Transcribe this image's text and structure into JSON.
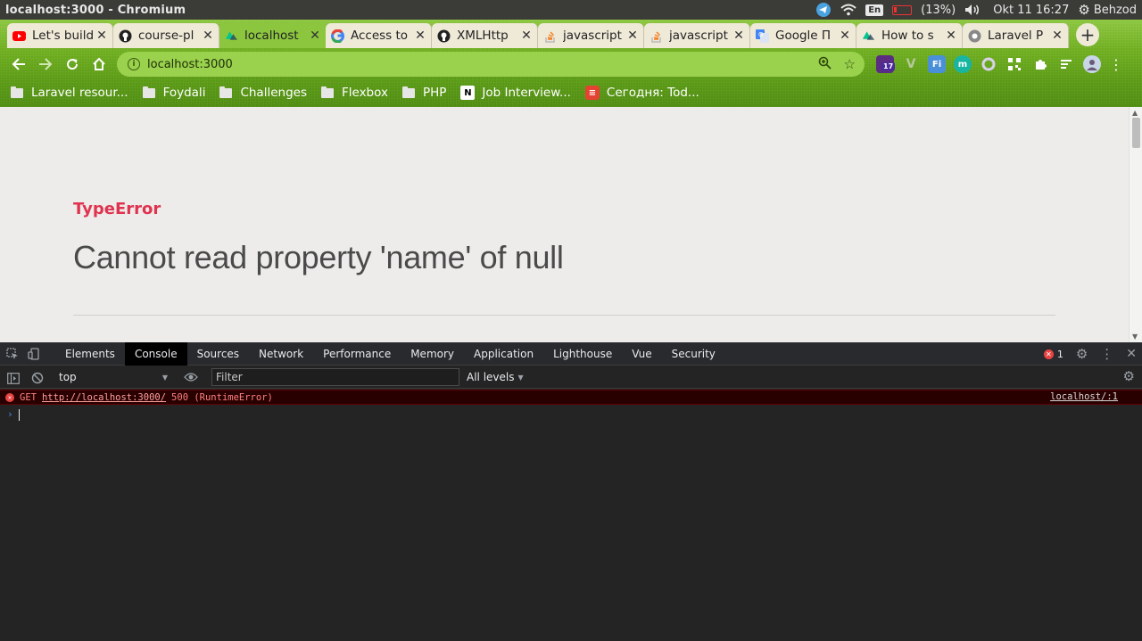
{
  "os": {
    "window_title": "localhost:3000 - Chromium",
    "lang": "En",
    "battery": "(13%)",
    "clock": "Okt 11 16:27",
    "user": "Behzod"
  },
  "tabs": [
    {
      "label": "Let's build",
      "icon": "youtube-icon",
      "active": false
    },
    {
      "label": "course-pl",
      "icon": "github-icon",
      "active": false
    },
    {
      "label": "localhost",
      "icon": "nuxt-icon",
      "active": true
    },
    {
      "label": "Access to",
      "icon": "google-icon",
      "active": false
    },
    {
      "label": "XMLHttp",
      "icon": "github-icon",
      "active": false
    },
    {
      "label": "javascript",
      "icon": "stackoverflow-icon",
      "active": false
    },
    {
      "label": "javascript",
      "icon": "stackoverflow-icon",
      "active": false
    },
    {
      "label": "Google П",
      "icon": "google-translate-icon",
      "active": false
    },
    {
      "label": "How to s",
      "icon": "nuxt-icon",
      "active": false
    },
    {
      "label": "Laravel P",
      "icon": "chrome-icon",
      "active": false
    }
  ],
  "omnibox": {
    "url": "localhost:3000"
  },
  "extensions": {
    "badge_count": "17"
  },
  "bookmarks": [
    {
      "label": "Laravel resour...",
      "icon": "folder-icon"
    },
    {
      "label": "Foydali",
      "icon": "folder-icon"
    },
    {
      "label": "Challenges",
      "icon": "folder-icon"
    },
    {
      "label": "Flexbox",
      "icon": "folder-icon"
    },
    {
      "label": "PHP",
      "icon": "folder-icon"
    },
    {
      "label": "Job Interview...",
      "icon": "notion-icon"
    },
    {
      "label": "Сегодня: Tod...",
      "icon": "todoist-icon"
    }
  ],
  "page": {
    "error_type": "TypeError",
    "error_message": "Cannot read property 'name' of null"
  },
  "devtools": {
    "tabs": [
      "Elements",
      "Console",
      "Sources",
      "Network",
      "Performance",
      "Memory",
      "Application",
      "Lighthouse",
      "Vue",
      "Security"
    ],
    "active_tab": "Console",
    "error_count": "1",
    "context": "top",
    "filter_placeholder": "Filter",
    "levels": "All levels",
    "log": {
      "method": "GET",
      "url": "http://localhost:3000/",
      "status": "500 (RuntimeError)",
      "source": "localhost/:1"
    }
  },
  "colors": {
    "error_red": "#e0334f",
    "theme_green": "#6fae1f"
  }
}
